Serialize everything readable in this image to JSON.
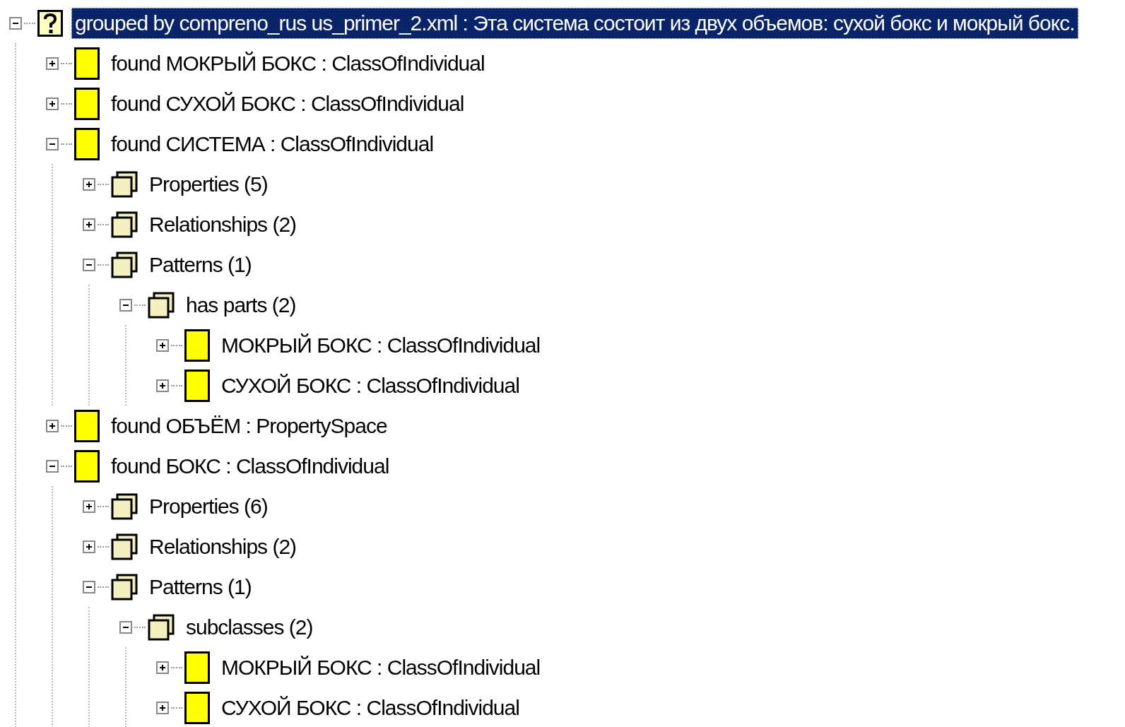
{
  "tree": [
    {
      "kind": "root",
      "label": "grouped by compreno_rus us_primer_2.xml : Эта система состоит из двух объемов: сухой бокс и мокрый бокс.",
      "expanded": true,
      "selected": true,
      "children": [
        {
          "kind": "class",
          "label": "found МОКРЫЙ БОКС : ClassOfIndividual",
          "expanded": false,
          "selected": false
        },
        {
          "kind": "class",
          "label": "found СУХОЙ БОКС : ClassOfIndividual",
          "expanded": false,
          "selected": false
        },
        {
          "kind": "class",
          "label": "found СИСТЕМА : ClassOfIndividual",
          "expanded": true,
          "selected": false,
          "children": [
            {
              "kind": "group",
              "label": "Properties (5)",
              "expanded": false,
              "selected": false
            },
            {
              "kind": "group",
              "label": "Relationships (2)",
              "expanded": false,
              "selected": false
            },
            {
              "kind": "group",
              "label": "Patterns (1)",
              "expanded": true,
              "selected": false,
              "children": [
                {
                  "kind": "group",
                  "label": "has parts (2)",
                  "expanded": true,
                  "selected": false,
                  "children": [
                    {
                      "kind": "class",
                      "label": "МОКРЫЙ БОКС : ClassOfIndividual",
                      "expanded": false,
                      "selected": false
                    },
                    {
                      "kind": "class",
                      "label": "СУХОЙ БОКС : ClassOfIndividual",
                      "expanded": false,
                      "selected": false
                    }
                  ]
                }
              ]
            }
          ]
        },
        {
          "kind": "class",
          "label": "found ОБЪЁМ : PropertySpace",
          "expanded": false,
          "selected": false
        },
        {
          "kind": "class",
          "label": "found БОКС : ClassOfIndividual",
          "expanded": true,
          "selected": false,
          "children": [
            {
              "kind": "group",
              "label": "Properties (6)",
              "expanded": false,
              "selected": false
            },
            {
              "kind": "group",
              "label": "Relationships (2)",
              "expanded": false,
              "selected": false
            },
            {
              "kind": "group",
              "label": "Patterns (1)",
              "expanded": true,
              "selected": false,
              "children": [
                {
                  "kind": "group",
                  "label": "subclasses (2)",
                  "expanded": true,
                  "selected": false,
                  "children": [
                    {
                      "kind": "class",
                      "label": "МОКРЫЙ БОКС : ClassOfIndividual",
                      "expanded": false,
                      "selected": false
                    },
                    {
                      "kind": "class",
                      "label": "СУХОЙ БОКС : ClassOfIndividual",
                      "expanded": false,
                      "selected": false
                    }
                  ]
                }
              ]
            }
          ]
        }
      ]
    }
  ]
}
